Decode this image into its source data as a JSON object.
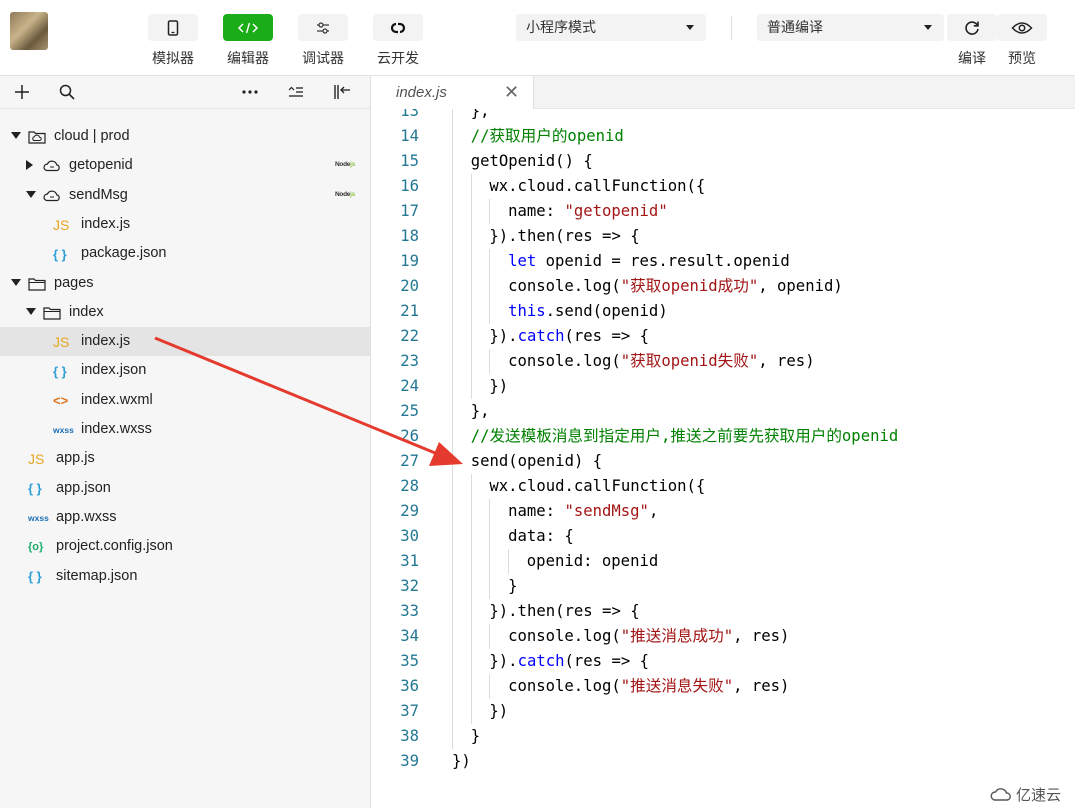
{
  "toolbar": {
    "tools": [
      {
        "label": "模拟器",
        "icon": "phone-icon"
      },
      {
        "label": "编辑器",
        "icon": "code-icon",
        "active": true
      },
      {
        "label": "调试器",
        "icon": "sliders-icon"
      },
      {
        "label": "云开发",
        "icon": "cloud-link-icon"
      }
    ],
    "mode_select": "小程序模式",
    "compile_select": "普通编译",
    "compile_label": "编译",
    "preview_label": "预览"
  },
  "tree": [
    {
      "name": "cloud | prod",
      "type": "cloud-folder",
      "expanded": true,
      "level": 0
    },
    {
      "name": "getopenid",
      "type": "cloud-function",
      "expanded": false,
      "level": 1,
      "badge": true
    },
    {
      "name": "sendMsg",
      "type": "cloud-function",
      "expanded": true,
      "level": 1,
      "badge": true
    },
    {
      "name": "index.js",
      "type": "js",
      "level": 2
    },
    {
      "name": "package.json",
      "type": "json",
      "level": 2
    },
    {
      "name": "pages",
      "type": "folder",
      "expanded": true,
      "level": 0
    },
    {
      "name": "index",
      "type": "folder",
      "expanded": true,
      "level": 1
    },
    {
      "name": "index.js",
      "type": "js",
      "level": 2,
      "selected": true
    },
    {
      "name": "index.json",
      "type": "json",
      "level": 2
    },
    {
      "name": "index.wxml",
      "type": "wxml",
      "level": 2
    },
    {
      "name": "index.wxss",
      "type": "wxss",
      "level": 2
    },
    {
      "name": "app.js",
      "type": "js",
      "level": 1
    },
    {
      "name": "app.json",
      "type": "json",
      "level": 1
    },
    {
      "name": "app.wxss",
      "type": "wxss",
      "level": 1
    },
    {
      "name": "project.config.json",
      "type": "config",
      "level": 1
    },
    {
      "name": "sitemap.json",
      "type": "json",
      "level": 1
    }
  ],
  "badge_text": {
    "node": "Node",
    "js": "js"
  },
  "icon_glyphs": {
    "js": "JS",
    "json": "{ }",
    "wxml": "<>",
    "wxss": "wxss",
    "config": "{o}"
  },
  "editor": {
    "tab_name": "index.js",
    "tab_close": "✕",
    "lines": [
      {
        "n": "13",
        "indent": 1,
        "tokens": [
          [
            "}",
            ""
          ],
          [
            ",",
            ""
          ]
        ]
      },
      {
        "n": "14",
        "indent": 1,
        "tokens": [
          [
            "//获取用户的openid",
            "com"
          ]
        ]
      },
      {
        "n": "15",
        "indent": 1,
        "tokens": [
          [
            "getOpenid() {",
            ""
          ]
        ]
      },
      {
        "n": "16",
        "indent": 2,
        "tokens": [
          [
            "wx.cloud.callFunction({",
            ""
          ]
        ]
      },
      {
        "n": "17",
        "indent": 3,
        "tokens": [
          [
            "name: ",
            ""
          ],
          [
            "\"getopenid\"",
            "str"
          ]
        ]
      },
      {
        "n": "18",
        "indent": 2,
        "tokens": [
          [
            "}).then(res => {",
            ""
          ]
        ]
      },
      {
        "n": "19",
        "indent": 3,
        "tokens": [
          [
            "let",
            "kw"
          ],
          [
            " openid = res.result.openid",
            ""
          ]
        ]
      },
      {
        "n": "20",
        "indent": 3,
        "tokens": [
          [
            "console.log(",
            ""
          ],
          [
            "\"获取openid成功\"",
            "str"
          ],
          [
            ", openid)",
            ""
          ]
        ]
      },
      {
        "n": "21",
        "indent": 3,
        "tokens": [
          [
            "this",
            "kw"
          ],
          [
            ".send(openid)",
            ""
          ]
        ]
      },
      {
        "n": "22",
        "indent": 2,
        "tokens": [
          [
            "}).",
            ""
          ],
          [
            "catch",
            "kw"
          ],
          [
            "(res => {",
            ""
          ]
        ]
      },
      {
        "n": "23",
        "indent": 3,
        "tokens": [
          [
            "console.log(",
            ""
          ],
          [
            "\"获取openid失败\"",
            "str"
          ],
          [
            ", res)",
            ""
          ]
        ]
      },
      {
        "n": "24",
        "indent": 2,
        "tokens": [
          [
            "})",
            ""
          ]
        ]
      },
      {
        "n": "25",
        "indent": 1,
        "tokens": [
          [
            "},",
            ""
          ]
        ]
      },
      {
        "n": "26",
        "indent": 1,
        "tokens": [
          [
            "//发送模板消息到指定用户,推送之前要先获取用户的openid",
            "com"
          ]
        ]
      },
      {
        "n": "27",
        "indent": 1,
        "tokens": [
          [
            "send(openid) {",
            ""
          ]
        ]
      },
      {
        "n": "28",
        "indent": 2,
        "tokens": [
          [
            "wx.cloud.callFunction({",
            ""
          ]
        ]
      },
      {
        "n": "29",
        "indent": 3,
        "tokens": [
          [
            "name: ",
            ""
          ],
          [
            "\"sendMsg\"",
            "str"
          ],
          [
            ",",
            ""
          ]
        ]
      },
      {
        "n": "30",
        "indent": 3,
        "tokens": [
          [
            "data: {",
            ""
          ]
        ]
      },
      {
        "n": "31",
        "indent": 4,
        "tokens": [
          [
            "openid: openid",
            ""
          ]
        ]
      },
      {
        "n": "32",
        "indent": 3,
        "tokens": [
          [
            "}",
            ""
          ]
        ]
      },
      {
        "n": "33",
        "indent": 2,
        "tokens": [
          [
            "}).then(res => {",
            ""
          ]
        ]
      },
      {
        "n": "34",
        "indent": 3,
        "tokens": [
          [
            "console.log(",
            ""
          ],
          [
            "\"推送消息成功\"",
            "str"
          ],
          [
            ", res)",
            ""
          ]
        ]
      },
      {
        "n": "35",
        "indent": 2,
        "tokens": [
          [
            "}).",
            ""
          ],
          [
            "catch",
            "kw"
          ],
          [
            "(res => {",
            ""
          ]
        ]
      },
      {
        "n": "36",
        "indent": 3,
        "tokens": [
          [
            "console.log(",
            ""
          ],
          [
            "\"推送消息失败\"",
            "str"
          ],
          [
            ", res)",
            ""
          ]
        ]
      },
      {
        "n": "37",
        "indent": 2,
        "tokens": [
          [
            "})",
            ""
          ]
        ]
      },
      {
        "n": "38",
        "indent": 1,
        "tokens": [
          [
            "}",
            ""
          ]
        ]
      },
      {
        "n": "39",
        "indent": 0,
        "tokens": [
          [
            "})",
            ""
          ]
        ]
      }
    ]
  },
  "watermark": "亿速云",
  "colors": {
    "accent": "#1aad19",
    "annotation_arrow": "#e53a2e",
    "comment": "#008000",
    "string": "#a31515",
    "keyword": "#0000ff",
    "line_number": "#237893"
  }
}
